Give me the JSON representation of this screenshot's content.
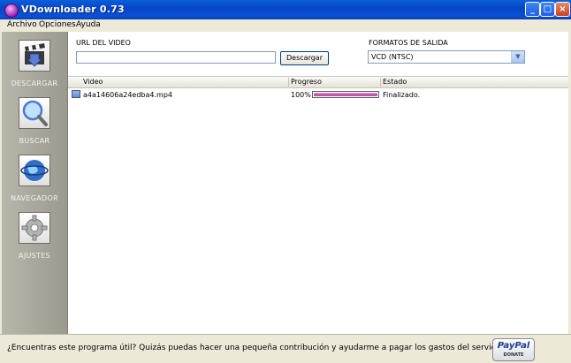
{
  "window": {
    "title": "VDownloader 0.73"
  },
  "menubar": {
    "items": [
      "Archivo",
      "Opciones",
      "Ayuda"
    ]
  },
  "sidebar": {
    "items": [
      {
        "label": "DESCARGAR",
        "icon": "clapperboard-download-icon"
      },
      {
        "label": "BUSCAR",
        "icon": "magnifier-icon"
      },
      {
        "label": "NAVEGADOR",
        "icon": "globe-icon"
      },
      {
        "label": "AJUSTES",
        "icon": "gear-icon"
      }
    ]
  },
  "form": {
    "url_label": "URL DEL VIDEO",
    "url_value": "",
    "download_button": "Descargar",
    "formats_label": "FORMATOS DE SALIDA",
    "format_selected": "VCD (NTSC)"
  },
  "table": {
    "headers": [
      "Video",
      "Progreso",
      "Estado"
    ],
    "rows": [
      {
        "video": "a4a14606a24edba4.mp4",
        "progress_text": "100%",
        "progress": 1.0,
        "status": "Finalizado."
      }
    ]
  },
  "statusbar": {
    "message": "¿Encuentras este programa útil? Quizás puedas hacer una pequeña contribución y ayudarme a pagar los gastos del servidor :-)",
    "paypal_logo": "PayPal",
    "paypal_sub": "DONATE"
  },
  "colors": {
    "titlebar": "#0a50d6",
    "progress_fill": "#b0489c",
    "sidebar": "#a7a59a"
  }
}
